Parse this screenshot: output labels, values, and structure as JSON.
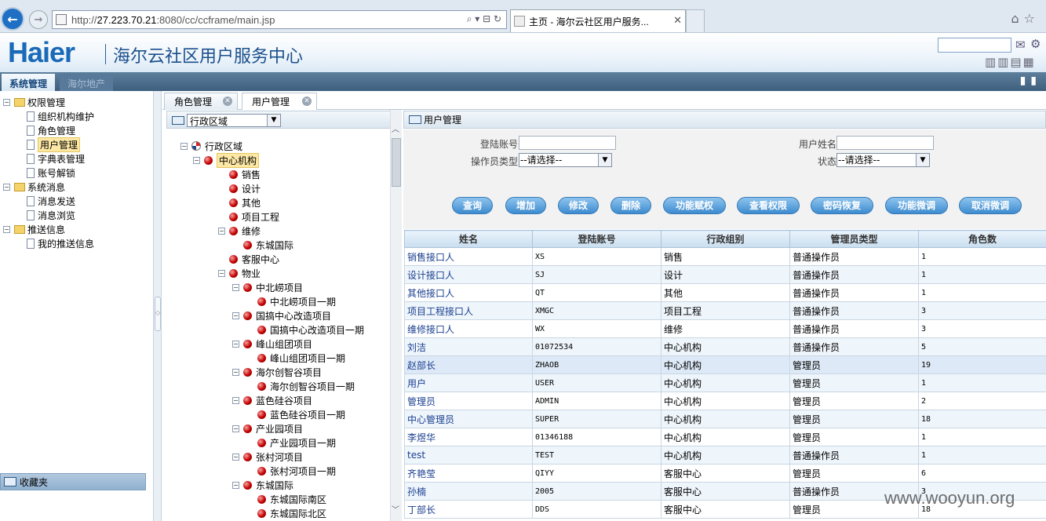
{
  "browser": {
    "url_prefix": "http://",
    "url_host": "27.223.70.21",
    "url_rest": ":8080/cc/ccframe/main.jsp",
    "tab_title": "主页 - 海尔云社区用户服务..."
  },
  "header": {
    "logo": "Haier",
    "title": "海尔云社区用户服务中心",
    "search_value": ""
  },
  "menubar": {
    "tabs": [
      "系统管理",
      "海尔地产"
    ]
  },
  "sidebar": {
    "items": [
      {
        "label": "权限管理",
        "level": 0,
        "type": "folder"
      },
      {
        "label": "组织机构维护",
        "level": 1,
        "type": "doc"
      },
      {
        "label": "角色管理",
        "level": 1,
        "type": "doc"
      },
      {
        "label": "用户管理",
        "level": 1,
        "type": "doc",
        "selected": true
      },
      {
        "label": "字典表管理",
        "level": 1,
        "type": "doc"
      },
      {
        "label": "账号解锁",
        "level": 1,
        "type": "doc"
      },
      {
        "label": "系统消息",
        "level": 0,
        "type": "folder"
      },
      {
        "label": "消息发送",
        "level": 1,
        "type": "doc"
      },
      {
        "label": "消息浏览",
        "level": 1,
        "type": "doc"
      },
      {
        "label": "推送信息",
        "level": 0,
        "type": "folder"
      },
      {
        "label": "我的推送信息",
        "level": 1,
        "type": "doc"
      }
    ],
    "favorites": "收藏夹"
  },
  "content_tabs": [
    {
      "label": "角色管理"
    },
    {
      "label": "用户管理",
      "active": true
    }
  ],
  "region_panel": {
    "select_value": "行政区域",
    "tree": [
      {
        "label": "行政区域",
        "level": 0,
        "type": "root",
        "toggle": "−"
      },
      {
        "label": "中心机构",
        "level": 1,
        "toggle": "−",
        "selected": true
      },
      {
        "label": "销售",
        "level": 2
      },
      {
        "label": "设计",
        "level": 2
      },
      {
        "label": "其他",
        "level": 2
      },
      {
        "label": "项目工程",
        "level": 2
      },
      {
        "label": "维修",
        "level": 2,
        "toggle": "−"
      },
      {
        "label": "东城国际",
        "level": 3
      },
      {
        "label": "客服中心",
        "level": 2
      },
      {
        "label": "物业",
        "level": 2,
        "toggle": "−"
      },
      {
        "label": "中北崂项目",
        "level": 3,
        "toggle": "−"
      },
      {
        "label": "中北崂项目一期",
        "level": 4
      },
      {
        "label": "国搞中心改造项目",
        "level": 3,
        "toggle": "−"
      },
      {
        "label": "国搞中心改造项目一期",
        "level": 4
      },
      {
        "label": "峰山组团项目",
        "level": 3,
        "toggle": "−"
      },
      {
        "label": "峰山组团项目一期",
        "level": 4
      },
      {
        "label": "海尔创智谷项目",
        "level": 3,
        "toggle": "−"
      },
      {
        "label": "海尔创智谷项目一期",
        "level": 4
      },
      {
        "label": "蓝色硅谷项目",
        "level": 3,
        "toggle": "−"
      },
      {
        "label": "蓝色硅谷项目一期",
        "level": 4
      },
      {
        "label": "产业园项目",
        "level": 3,
        "toggle": "−"
      },
      {
        "label": "产业园项目一期",
        "level": 4
      },
      {
        "label": "张村河项目",
        "level": 3,
        "toggle": "−"
      },
      {
        "label": "张村河项目一期",
        "level": 4
      },
      {
        "label": "东城国际",
        "level": 3,
        "toggle": "−"
      },
      {
        "label": "东城国际南区",
        "level": 4
      },
      {
        "label": "东城国际北区",
        "level": 4
      }
    ]
  },
  "user_mgmt": {
    "title": "用户管理",
    "filters": {
      "login_label": "登陆账号",
      "login_value": "",
      "username_label": "用户姓名",
      "username_value": "",
      "optype_label": "操作员类型",
      "optype_value": "--请选择--",
      "status_label": "状态",
      "status_value": "--请选择--"
    },
    "buttons": [
      "查询",
      "增加",
      "修改",
      "删除",
      "功能赋权",
      "查看权限",
      "密码恢复",
      "功能微调",
      "取消微调"
    ],
    "columns": [
      "姓名",
      "登陆账号",
      "行政组别",
      "管理员类型",
      "角色数"
    ],
    "rows": [
      [
        "销售接口人",
        "XS",
        "销售",
        "普通操作员",
        "1"
      ],
      [
        "设计接口人",
        "SJ",
        "设计",
        "普通操作员",
        "1"
      ],
      [
        "其他接口人",
        "QT",
        "其他",
        "普通操作员",
        "1"
      ],
      [
        "项目工程接口人",
        "XMGC",
        "项目工程",
        "普通操作员",
        "3"
      ],
      [
        "维修接口人",
        "WX",
        "维修",
        "普通操作员",
        "3"
      ],
      [
        "刘洁",
        "01072534",
        "中心机构",
        "普通操作员",
        "5"
      ],
      [
        "赵部长",
        "ZHAOB",
        "中心机构",
        "管理员",
        "19"
      ],
      [
        "用户",
        "USER",
        "中心机构",
        "管理员",
        "1"
      ],
      [
        "管理员",
        "ADMIN",
        "中心机构",
        "管理员",
        "2"
      ],
      [
        "中心管理员",
        "SUPER",
        "中心机构",
        "管理员",
        "18"
      ],
      [
        "李煜华",
        "01346188",
        "中心机构",
        "管理员",
        "1"
      ],
      [
        "test",
        "TEST",
        "中心机构",
        "普通操作员",
        "1"
      ],
      [
        "齐艳莹",
        "QIYY",
        "客服中心",
        "管理员",
        "6"
      ],
      [
        "孙楠",
        "2005",
        "客服中心",
        "普通操作员",
        "3"
      ],
      [
        "丁部长",
        "DDS",
        "客服中心",
        "管理员",
        "18"
      ]
    ]
  },
  "watermark": "www.wooyun.org",
  "colors": {
    "brand": "#1a6ab8",
    "menubar": "#4a6b8a",
    "button": "#3d8bcf",
    "selected": "#fde8a6"
  }
}
